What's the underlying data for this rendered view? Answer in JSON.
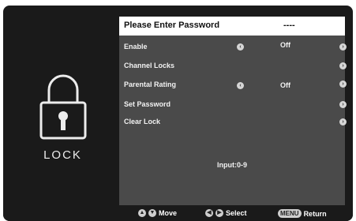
{
  "sidebar": {
    "label": "LOCK",
    "icon": "lock-icon"
  },
  "menu": {
    "header": {
      "title": "Please Enter Password",
      "value": "----"
    },
    "items": [
      {
        "label": "Enable",
        "value": "Off"
      },
      {
        "label": "Channel Locks"
      },
      {
        "label": "Parental Rating",
        "value": "Off"
      },
      {
        "label": "Set Password"
      },
      {
        "label": "Clear Lock"
      }
    ],
    "input_hint": "Input:0-9"
  },
  "footer": {
    "move_label": "Move",
    "select_label": "Select",
    "menu_key": "MENU",
    "return_label": "Return"
  },
  "colors": {
    "background": "#1a1a1a",
    "panel": "#4a4a4a",
    "header": "#ffffff",
    "text": "#f2f2f2"
  }
}
